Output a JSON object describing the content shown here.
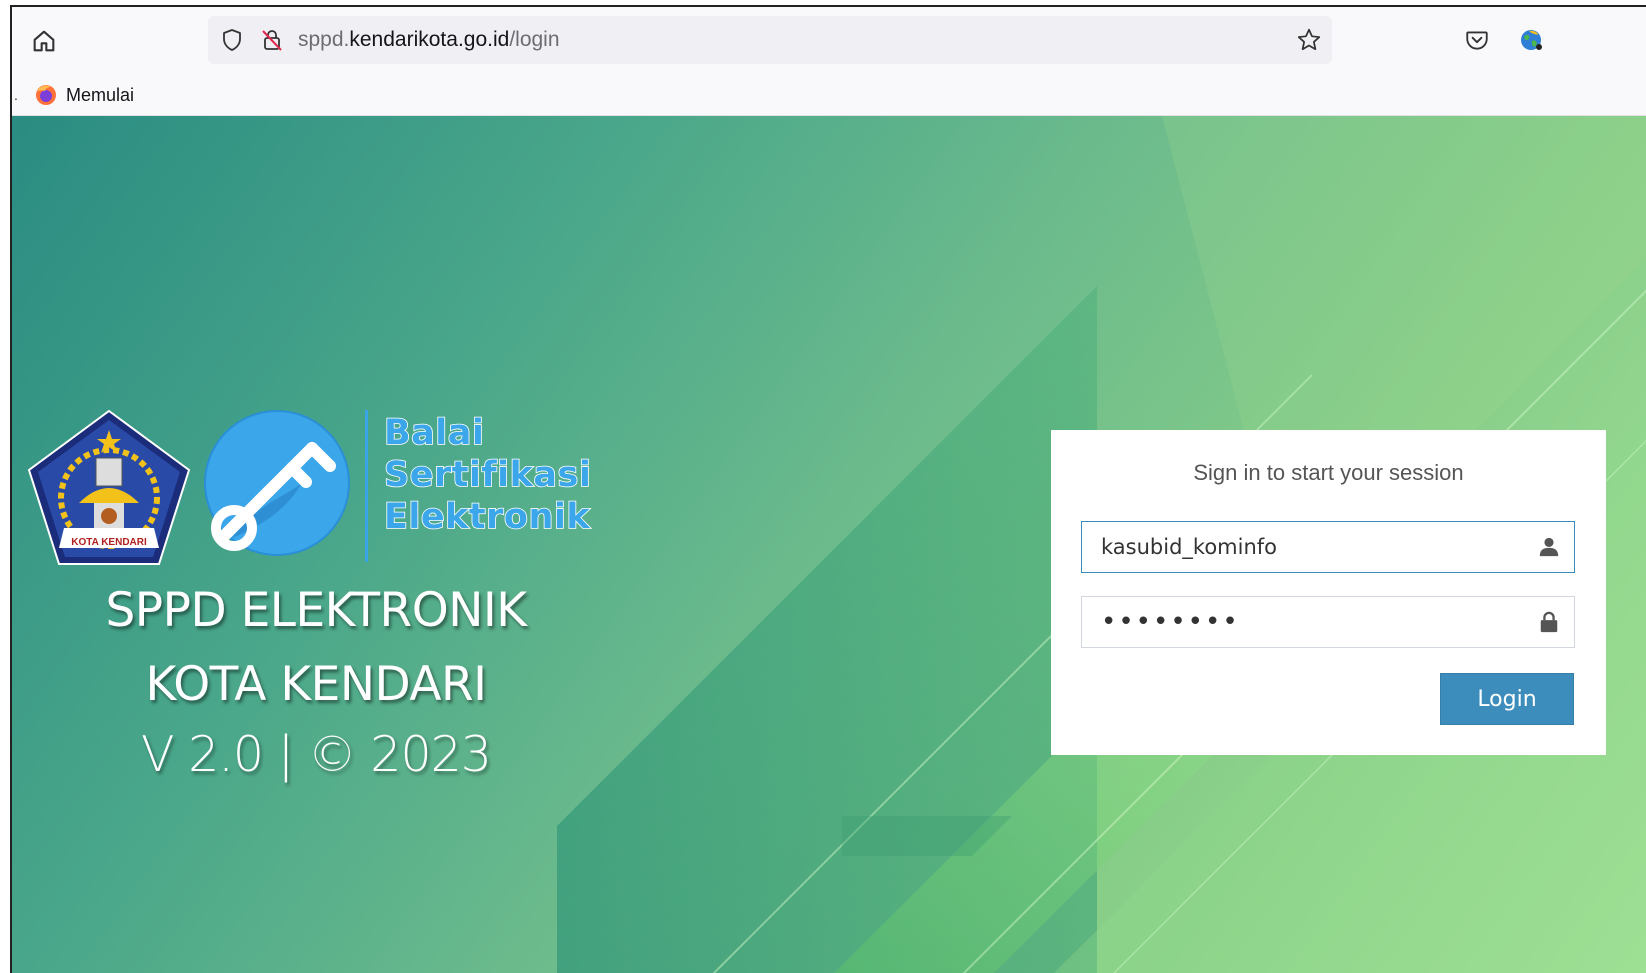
{
  "browser": {
    "url_prefix": "sppd.",
    "url_host": "kendarikota.go.id",
    "url_path": "/login",
    "bookmark_dot": ".",
    "bookmark_label": "Memulai"
  },
  "brand": {
    "bse_line1": "Balai",
    "bse_line2": "Sertifikasi",
    "bse_line3": "Elektronik",
    "emblem_caption": "KOTA KENDARI",
    "title_line1": "SPPD ELEKTRONIK",
    "title_line2": "KOTA KENDARI",
    "version_text": "V 2.0 | © 2023"
  },
  "login": {
    "message": "Sign in to start your session",
    "username_value": "kasubid_kominfo",
    "password_masked": "••••••••",
    "button_label": "Login"
  },
  "colors": {
    "accent": "#3c8dbc",
    "bse_blue": "#3ba6ea"
  }
}
